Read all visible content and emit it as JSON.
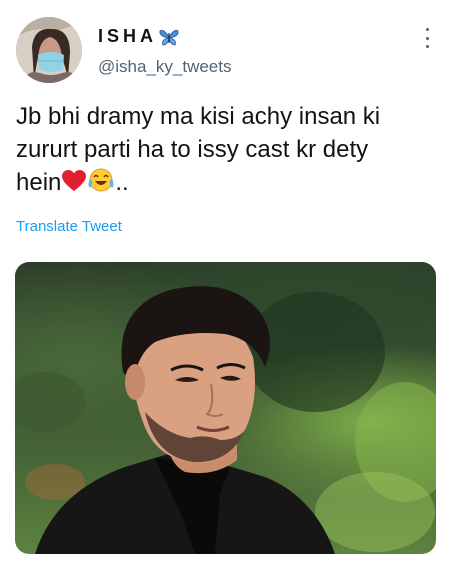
{
  "tweet": {
    "display_name": "ISHA",
    "handle": "@isha_ky_tweets",
    "text_line1": "Jb bhi dramy ma kisi achy insan ki",
    "text_line2": "zururt parti ha to issy cast kr dety",
    "text_line3": "hein",
    "text_tail": "..",
    "translate_label": "Translate Tweet"
  },
  "icons": {
    "name_emoji": "butterfly-icon",
    "text_emojis": [
      "red-heart-emoji",
      "tears-of-joy-emoji"
    ],
    "more": "more-options-icon"
  },
  "colors": {
    "link": "#1d9bf0",
    "secondary_text": "#536471",
    "primary_text": "#0f1419"
  }
}
